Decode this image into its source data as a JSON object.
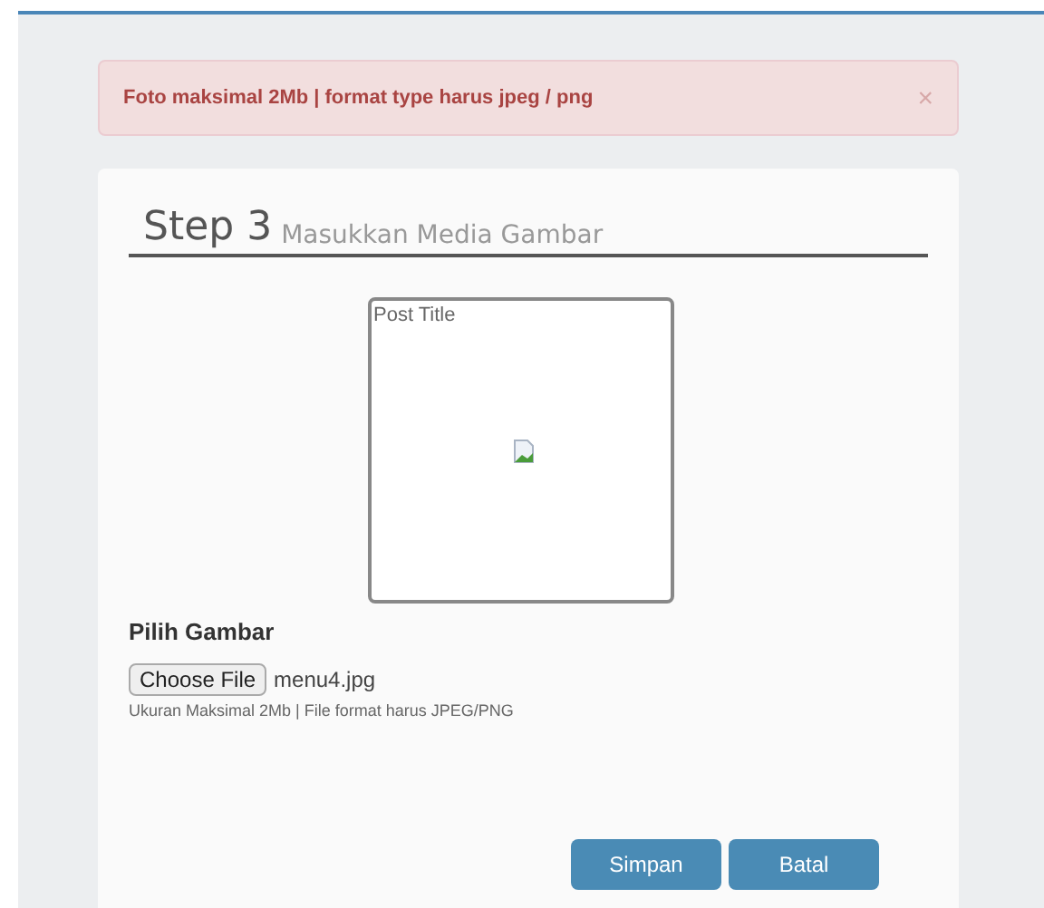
{
  "alert": {
    "message": "Foto maksimal 2Mb | format type harus jpeg / png",
    "close": "×"
  },
  "step": {
    "number": "Step 3",
    "title": "Masukkan Media Gambar"
  },
  "preview": {
    "alt": "Post Title"
  },
  "upload": {
    "label": "Pilih Gambar",
    "button": "Choose File",
    "filename": "menu4.jpg",
    "hint": "Ukuran Maksimal 2Mb | File format harus JPEG/PNG"
  },
  "buttons": [
    "Simpan",
    "Batal"
  ]
}
